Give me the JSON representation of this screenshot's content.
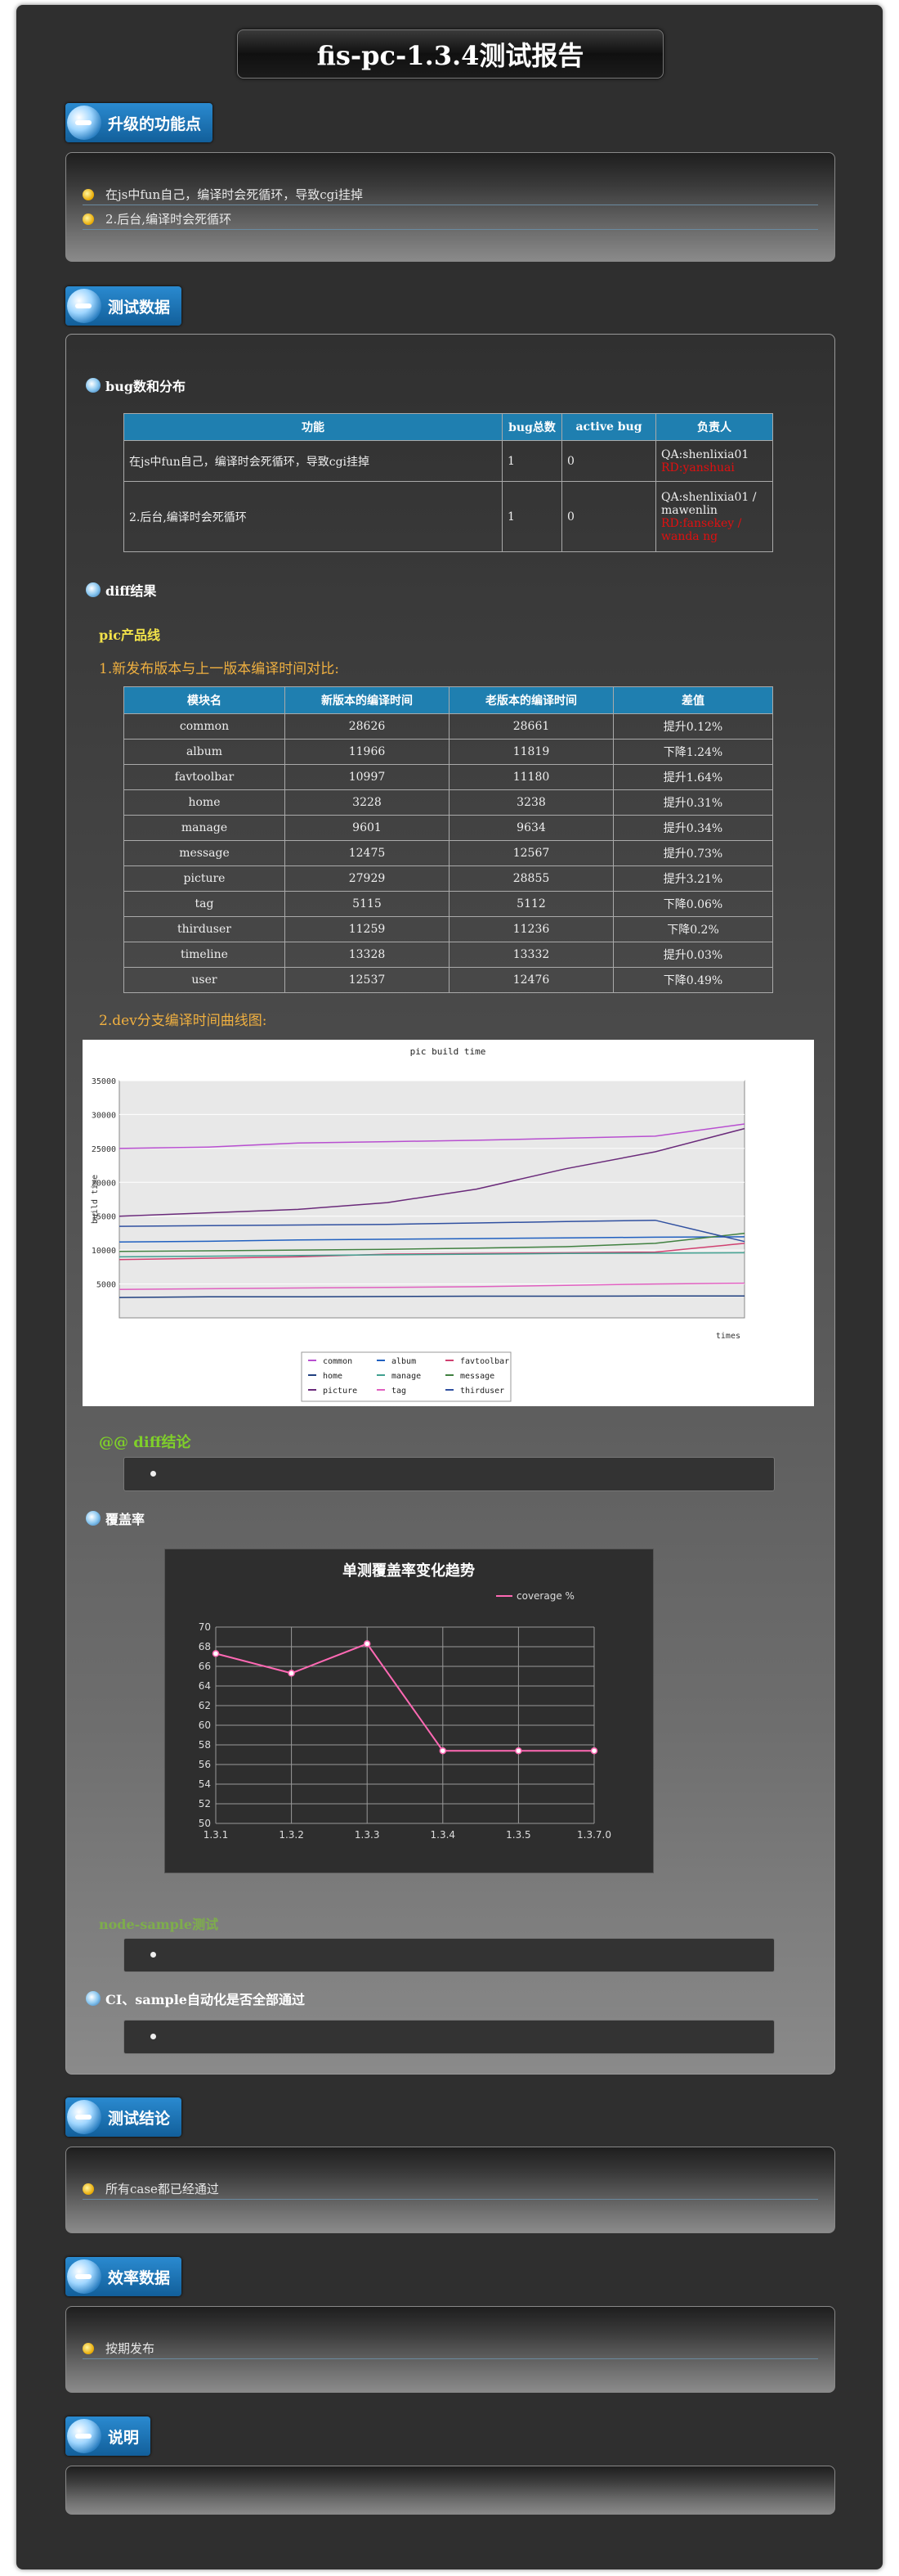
{
  "title": "fis-pc-1.3.4测试报告",
  "sections": {
    "upgrade": {
      "label": "升级的功能点",
      "items": [
        "在js中fun自己，编译时会死循环，导致cgi挂掉",
        "2.后台,编译时会死循环"
      ]
    },
    "testdata": {
      "label": "测试数据"
    },
    "conclusion": {
      "label": "测试结论",
      "items": [
        "所有case都已经通过"
      ]
    },
    "efficiency": {
      "label": "效率数据",
      "items": [
        "按期发布"
      ]
    },
    "notes": {
      "label": "说明"
    }
  },
  "bug": {
    "heading": "bug数和分布",
    "headers": [
      "功能",
      "bug总数",
      "active bug",
      "负责人"
    ],
    "rows": [
      {
        "feature": "在js中fun自己，编译时会死循环，导致cgi挂掉",
        "total": "1",
        "active": "0",
        "owner": "QA:shenlixia01",
        "owner2": "RD:yanshuai"
      },
      {
        "feature": "2.后台,编译时会死循环",
        "total": "1",
        "active": "0",
        "owner": "QA:shenlixia01 / mawenlin",
        "owner2": "RD:fansekey / wanda ng"
      }
    ]
  },
  "diff": {
    "heading": "diff结果",
    "line": "pic产品线",
    "caption1": "1.新发布版本与上一版本编译时间对比:",
    "headers": [
      "模块名",
      "新版本的编译时间",
      "老版本的编译时间",
      "差值"
    ],
    "rows": [
      {
        "name": "common",
        "new": "28626",
        "old": "28661",
        "diff": "提升0.12%",
        "up": true
      },
      {
        "name": "album",
        "new": "11966",
        "old": "11819",
        "diff": "下降1.24%",
        "up": false
      },
      {
        "name": "favtoolbar",
        "new": "10997",
        "old": "11180",
        "diff": "提升1.64%",
        "up": true
      },
      {
        "name": "home",
        "new": "3228",
        "old": "3238",
        "diff": "提升0.31%",
        "up": true
      },
      {
        "name": "manage",
        "new": "9601",
        "old": "9634",
        "diff": "提升0.34%",
        "up": true
      },
      {
        "name": "message",
        "new": "12475",
        "old": "12567",
        "diff": "提升0.73%",
        "up": true
      },
      {
        "name": "picture",
        "new": "27929",
        "old": "28855",
        "diff": "提升3.21%",
        "up": true
      },
      {
        "name": "tag",
        "new": "5115",
        "old": "5112",
        "diff": "下降0.06%",
        "up": false
      },
      {
        "name": "thirduser",
        "new": "11259",
        "old": "11236",
        "diff": "下降0.2%",
        "up": false
      },
      {
        "name": "timeline",
        "new": "13328",
        "old": "13332",
        "diff": "提升0.03%",
        "up": true
      },
      {
        "name": "user",
        "new": "12537",
        "old": "12476",
        "diff": "下降0.49%",
        "up": false
      }
    ],
    "caption2": "2.dev分支编译时间曲线图:",
    "conclusion": "@@ diff结论"
  },
  "coverage": {
    "heading": "覆盖率",
    "other": "node-sample测试"
  },
  "ci": {
    "heading": "CI、sample自动化是否全部通过"
  },
  "chart_data": [
    {
      "type": "line",
      "title": "pic build time",
      "xlabel": "times",
      "ylabel": "build time",
      "ylim": [
        0,
        35000
      ],
      "yticks": [
        5000,
        10000,
        15000,
        20000,
        25000,
        30000,
        35000
      ],
      "legend_position": "bottom",
      "series": [
        {
          "name": "common",
          "color": "#b84fd0",
          "values": [
            25000,
            25200,
            25800,
            26000,
            26200,
            26500,
            26800,
            28600
          ]
        },
        {
          "name": "album",
          "color": "#2060c0",
          "values": [
            11200,
            11300,
            11500,
            11600,
            11700,
            11800,
            11900,
            11966
          ]
        },
        {
          "name": "favtoolbar",
          "color": "#d04070",
          "values": [
            8600,
            8800,
            9000,
            9400,
            9500,
            9600,
            9700,
            10997
          ]
        },
        {
          "name": "home",
          "color": "#204080",
          "values": [
            3000,
            3100,
            3100,
            3150,
            3200,
            3200,
            3220,
            3228
          ]
        },
        {
          "name": "manage",
          "color": "#40a090",
          "values": [
            9000,
            9100,
            9200,
            9300,
            9400,
            9500,
            9550,
            9601
          ]
        },
        {
          "name": "message",
          "color": "#408040",
          "values": [
            9800,
            9900,
            10000,
            10100,
            10300,
            10500,
            11000,
            12475
          ]
        },
        {
          "name": "picture",
          "color": "#6a2a7a",
          "values": [
            15000,
            15500,
            16000,
            17000,
            19000,
            22000,
            24500,
            27929
          ]
        },
        {
          "name": "tag",
          "color": "#e060c0",
          "values": [
            4200,
            4300,
            4400,
            4500,
            4600,
            4800,
            5000,
            5115
          ]
        },
        {
          "name": "thirduser",
          "color": "#3050a0",
          "values": [
            13500,
            13600,
            13700,
            13800,
            14000,
            14200,
            14400,
            11259
          ]
        }
      ]
    },
    {
      "type": "line",
      "title": "单测覆盖率变化趋势",
      "categories": [
        "1.3.1",
        "1.3.2",
        "1.3.3",
        "1.3.4",
        "1.3.5",
        "1.3.7.0"
      ],
      "series": [
        {
          "name": "coverage %",
          "color": "#ff69b4",
          "values": [
            67.3,
            65.3,
            68.3,
            57.4,
            57.4,
            57.4
          ]
        }
      ],
      "ylim": [
        50,
        70
      ],
      "yticks": [
        50,
        52,
        54,
        56,
        58,
        60,
        62,
        64,
        66,
        68,
        70
      ]
    }
  ]
}
